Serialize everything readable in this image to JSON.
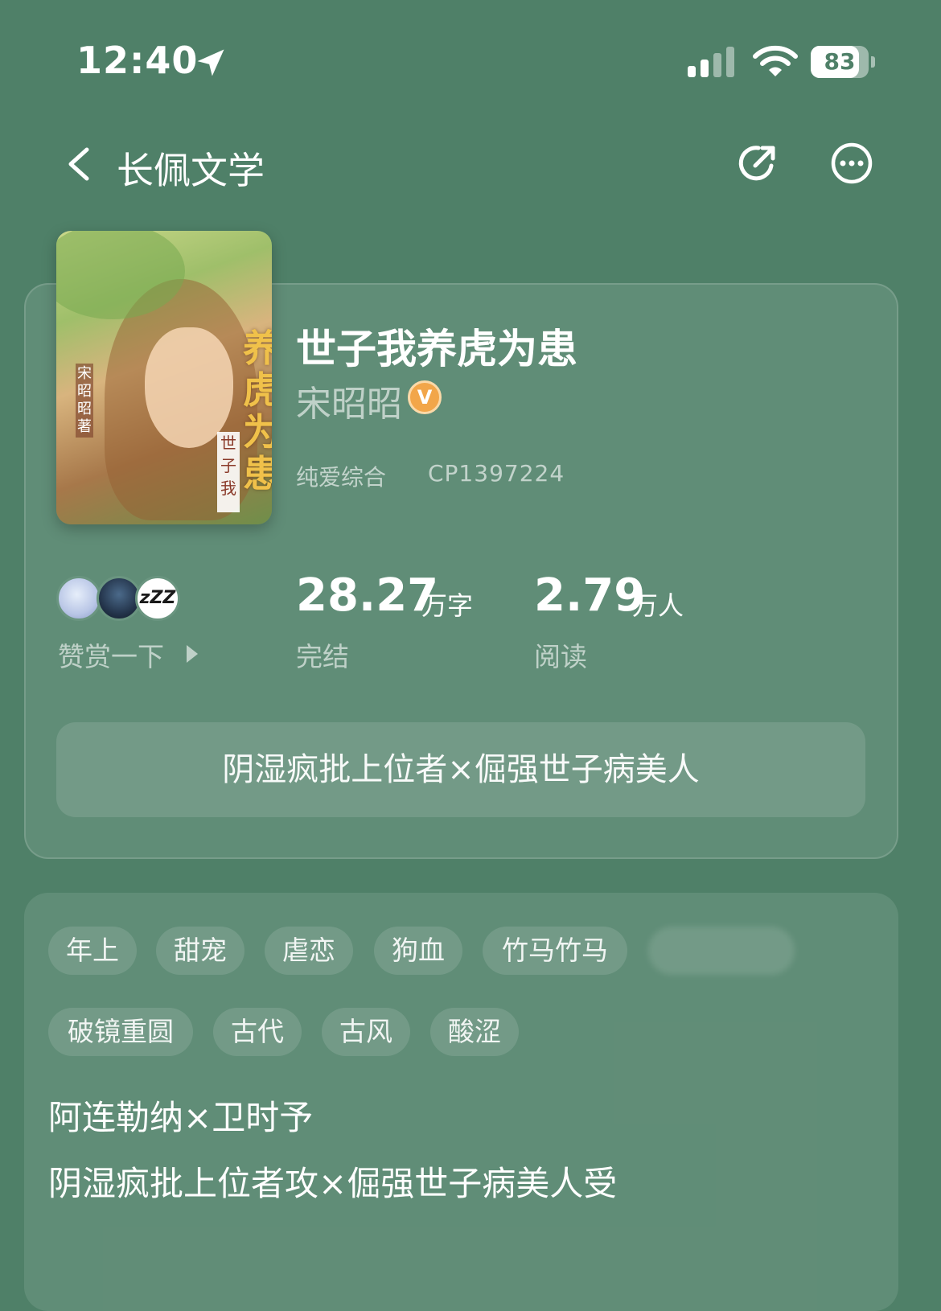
{
  "status_bar": {
    "time": "12:40",
    "battery": "83",
    "battery_level": 0.83
  },
  "nav": {
    "title": "长佩文学"
  },
  "book": {
    "cover": {
      "title_text": "养虎为患",
      "subtitle_text": "世子我",
      "author_text": "宋昭昭著"
    },
    "title": "世子我养虎为患",
    "author": "宋昭昭",
    "verified_badge": "V",
    "category": "纯爱综合",
    "cp_id": "CP1397224",
    "reward_label": "赞赏一下",
    "avatar3_text": "zZZ",
    "stats": [
      {
        "value": "28.27",
        "unit": "万字",
        "label": "完结"
      },
      {
        "value": "2.79",
        "unit": "万人",
        "label": "阅读"
      }
    ],
    "tagline": "阴湿疯批上位者×倔强世子病美人"
  },
  "tags": {
    "row1": [
      "年上",
      "甜宠",
      "虐恋",
      "狗血",
      "竹马竹马"
    ],
    "row2": [
      "破镜重圆",
      "古代",
      "古风",
      "酸涩"
    ]
  },
  "description": {
    "line1": "阿连勒纳×卫时予",
    "line2": "阴湿疯批上位者攻×倔强世子病美人受"
  },
  "colors": {
    "background": "#4f8068",
    "badge": "#f2a64a"
  },
  "icons": [
    "location-arrow-icon",
    "signal-icon",
    "wifi-icon",
    "battery-icon",
    "back-icon",
    "share-icon",
    "more-icon",
    "verified-icon",
    "play-arrow-icon"
  ]
}
